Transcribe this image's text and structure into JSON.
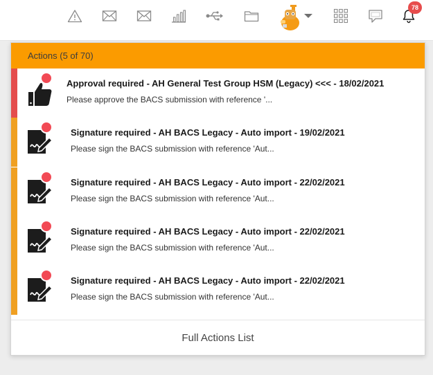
{
  "topbar": {
    "icons": [
      "warning-icon",
      "mail-icon",
      "mail-outline-icon",
      "bar-chart-icon",
      "usb-icon",
      "folder-icon",
      "avatar",
      "chevron-down-icon",
      "apps-grid-icon",
      "chat-icon",
      "bell-icon"
    ],
    "notification_count": "78"
  },
  "actions_panel": {
    "header": "Actions (5 of 70)",
    "items": [
      {
        "icon": "thumbs-up-icon",
        "accent": "#e44d4d",
        "title": "Approval required - AH General Test Group HSM (Legacy) <<< - 18/02/2021",
        "description": "Please approve the BACS submission with reference '..."
      },
      {
        "icon": "signature-icon",
        "accent": "#f0a022",
        "title": "Signature required - AH BACS Legacy - Auto import - 19/02/2021",
        "description": "Please sign the BACS submission with reference 'Aut..."
      },
      {
        "icon": "signature-icon",
        "accent": "#f0a022",
        "title": "Signature required - AH BACS Legacy - Auto import - 22/02/2021",
        "description": "Please sign the BACS submission with reference 'Aut..."
      },
      {
        "icon": "signature-icon",
        "accent": "#f0a022",
        "title": "Signature required - AH BACS Legacy - Auto import - 22/02/2021",
        "description": "Please sign the BACS submission with reference 'Aut..."
      },
      {
        "icon": "signature-icon",
        "accent": "#f0a022",
        "title": "Signature required - AH BACS Legacy - Auto import - 22/02/2021",
        "description": "Please sign the BACS submission with reference 'Aut..."
      }
    ],
    "footer": "Full Actions List"
  },
  "colors": {
    "header_bg": "#fb9b00",
    "unread_dot": "#f24a55",
    "badge": "#e74c4c"
  }
}
